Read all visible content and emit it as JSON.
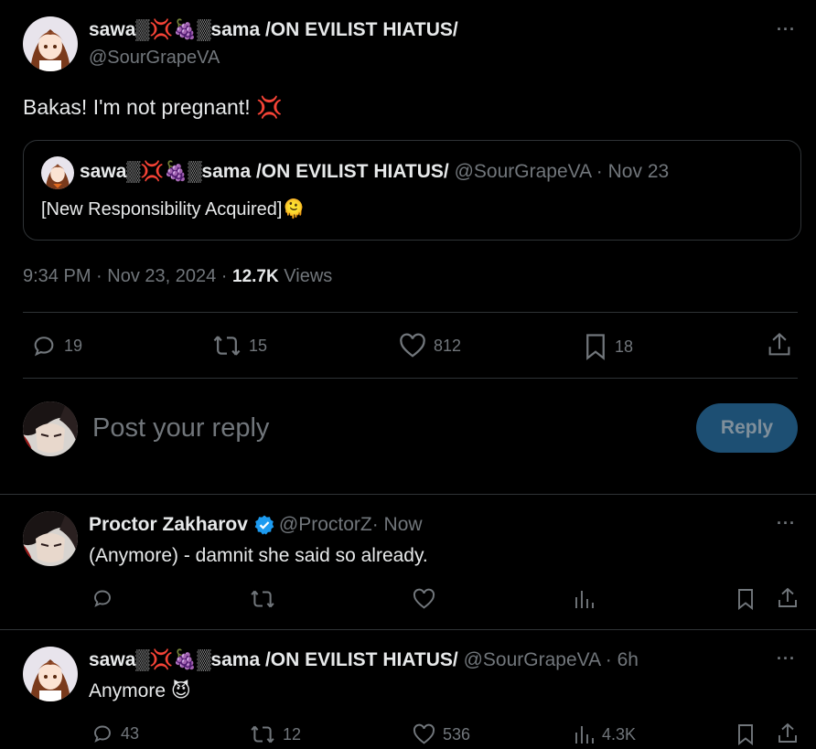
{
  "main_tweet": {
    "display_name": "sawa▒💢🍇▒sama /ON EVILIST HIATUS/",
    "handle": "@SourGrapeVA",
    "text": "Bakas! I'm not pregnant! 💢",
    "quoted": {
      "display_name": "sawa▒💢🍇▒sama /ON EVILIST HIATUS/",
      "handle": "@SourGrapeVA",
      "dot": "·",
      "date": "Nov 23",
      "text": "[New Responsibility Acquired]🫠"
    },
    "timestamp": "9:34 PM · Nov 23, 2024 · ",
    "views_count": "12.7K",
    "views_label": " Views",
    "stats": {
      "replies": "19",
      "reposts": "15",
      "likes": "812",
      "bookmarks": "18"
    }
  },
  "composer": {
    "placeholder": "Post your reply",
    "button_label": "Reply"
  },
  "replies": [
    {
      "display_name": "Proctor Zakharov",
      "handle": "@ProctorZ",
      "time": " · Now",
      "text": "(Anymore) - damnit she said so already.",
      "stats": {
        "replies": "",
        "reposts": "",
        "likes": "",
        "views": ""
      }
    },
    {
      "display_name": "sawa▒💢🍇▒sama /ON EVILIST HIATUS/",
      "handle": "@SourGrapeVA",
      "time": " · 6h",
      "text": "Anymore 😈",
      "stats": {
        "replies": "43",
        "reposts": "12",
        "likes": "536",
        "views": "4.3K"
      }
    }
  ],
  "icons": [
    "more-icon",
    "reply-icon",
    "repost-icon",
    "like-icon",
    "bookmark-icon",
    "share-icon",
    "views-icon",
    "verified-icon"
  ],
  "colors": {
    "background": "#000000",
    "text": "#e7e9ea",
    "muted": "#71767b",
    "border": "#2f3336",
    "accent": "#1d9bf0",
    "reply_button": "#1d4f73"
  }
}
